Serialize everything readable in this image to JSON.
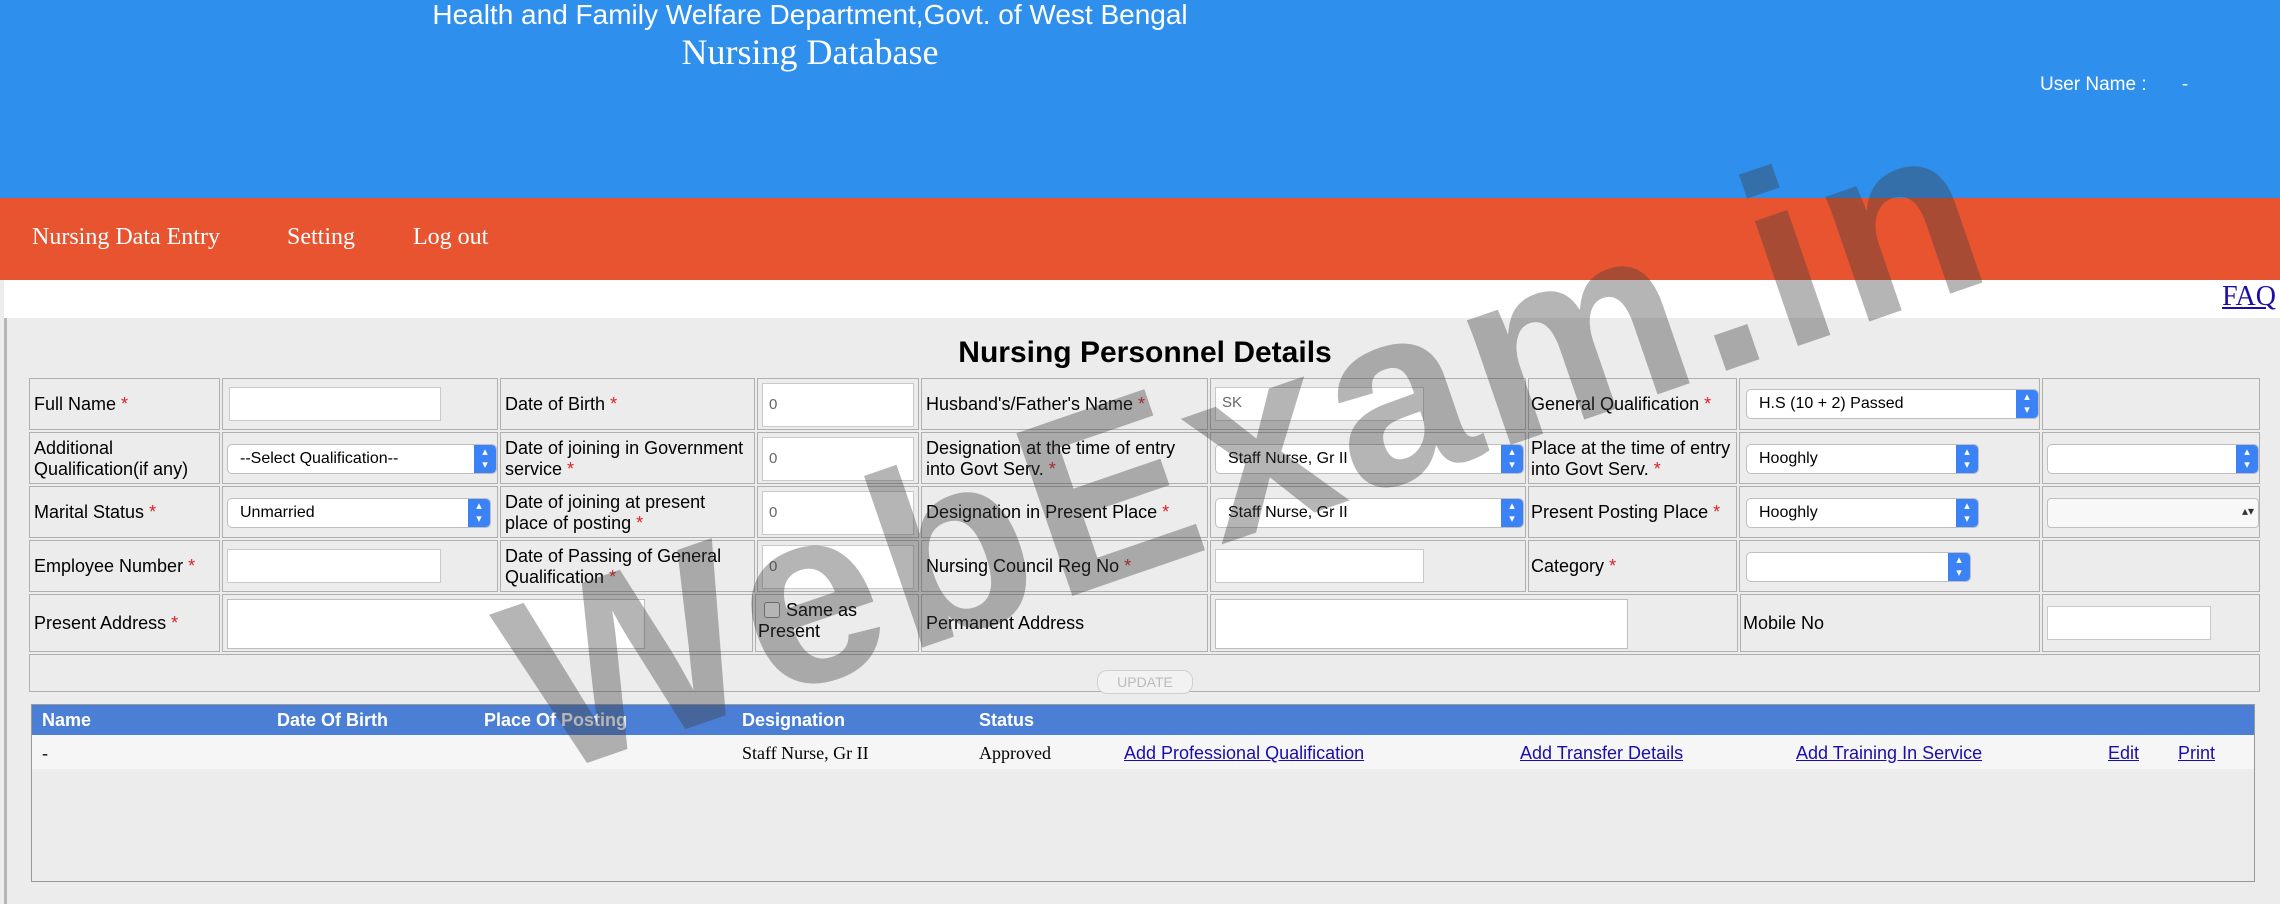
{
  "header": {
    "department": "Health and Family Welfare Department,Govt. of West Bengal",
    "app_title": "Nursing Database",
    "user_label": "User Name :",
    "user_value": "-"
  },
  "nav": {
    "items": [
      {
        "label": "Nursing Data Entry"
      },
      {
        "label": "Setting"
      },
      {
        "label": "Log out"
      }
    ]
  },
  "faq": "FAQ",
  "form": {
    "title": "Nursing Personnel Details",
    "required_mark": "*",
    "full_name": {
      "label": "Full Name",
      "value": ""
    },
    "date_of_birth": {
      "label": "Date of Birth",
      "value": "0"
    },
    "husband_father_name": {
      "label": "Husband's/Father's Name",
      "value": "SK"
    },
    "general_qualification": {
      "label": "General Qualification",
      "value": "H.S (10 + 2) Passed"
    },
    "additional_qualification": {
      "label": "Additional Qualification(if any)",
      "value": "--Select Qualification--"
    },
    "date_joining_govt": {
      "label": "Date of joining in Government service",
      "value": "0"
    },
    "designation_entry": {
      "label": "Designation at the time of entry into Govt Serv.",
      "value": "Staff Nurse, Gr II"
    },
    "place_entry": {
      "label": "Place at the time of entry into Govt Serv.",
      "value": "Hooghly"
    },
    "place_entry_extra": {
      "value": ""
    },
    "marital_status": {
      "label": "Marital Status",
      "value": "Unmarried"
    },
    "date_joining_present": {
      "label": "Date of joining at present place of posting",
      "value": "0"
    },
    "designation_present": {
      "label": "Designation in Present Place",
      "value": "Staff Nurse, Gr II"
    },
    "present_posting_place": {
      "label": "Present Posting Place",
      "value": "Hooghly"
    },
    "present_posting_extra": {
      "value": ""
    },
    "employee_number": {
      "label": "Employee Number",
      "value": ""
    },
    "date_passing_general": {
      "label": "Date of Passing of General Qualification",
      "value": "0"
    },
    "nursing_council_reg": {
      "label": "Nursing Council Reg No",
      "value": ""
    },
    "category": {
      "label": "Category",
      "value": ""
    },
    "present_address": {
      "label": "Present Address",
      "value": ""
    },
    "same_as_present": {
      "label": "Same as Present",
      "checked": false
    },
    "permanent_address": {
      "label": "Permanent Address",
      "value": ""
    },
    "mobile_no": {
      "label": "Mobile No",
      "value": ""
    },
    "update_button": "UPDATE"
  },
  "grid": {
    "columns": [
      "Name",
      "Date Of Birth",
      "Place Of Posting",
      "Designation",
      "Status"
    ],
    "rows": [
      {
        "name": "-",
        "dob": "",
        "place": "",
        "designation": "Staff Nurse, Gr II",
        "status": "Approved",
        "actions": [
          "Add Professional Qualification",
          "Add Transfer Details",
          "Add Training In Service",
          "Edit",
          "Print"
        ]
      }
    ]
  },
  "watermark": "WebExam.in",
  "colors": {
    "header_bg": "#2f8fec",
    "nav_bg": "#e85430",
    "grid_head_bg": "#4b7fd6",
    "required": "#dd2222",
    "link": "#1a0dab"
  }
}
